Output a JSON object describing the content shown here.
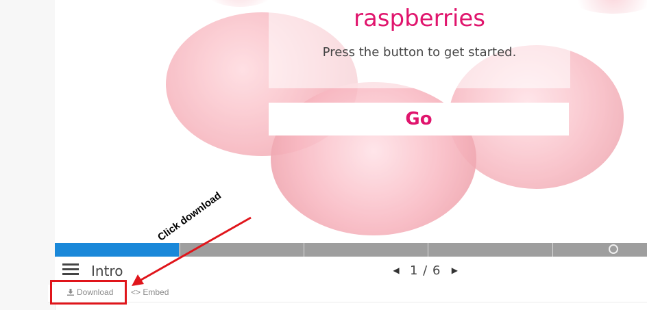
{
  "slide": {
    "title": "raspberries",
    "subtitle": "Press the button to get started.",
    "go_label": "Go"
  },
  "progress": {
    "fraction": 0.21,
    "segments": 6
  },
  "nav": {
    "menu_icon": "hamburger-menu-icon",
    "section_title": "Intro",
    "prev_icon": "triangle-left",
    "next_icon": "triangle-right",
    "page_text": "1 / 6"
  },
  "footer": {
    "download_label": "Download",
    "embed_label": "<> Embed"
  },
  "annotation": {
    "text": "Click download"
  },
  "colors": {
    "accent": "#e0156d",
    "progress_fill": "#1a88d9",
    "progress_track": "#9e9e9e",
    "annotation": "#e0151b"
  }
}
